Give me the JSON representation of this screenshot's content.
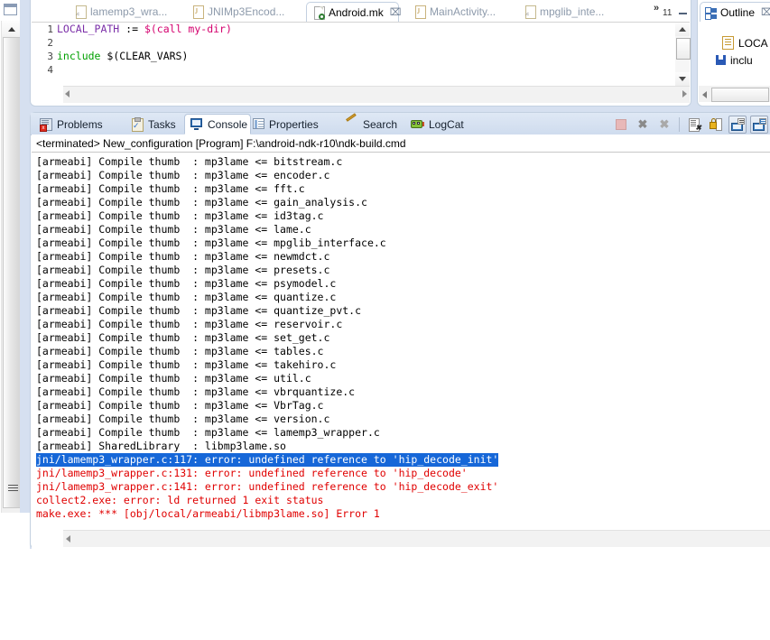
{
  "editor": {
    "tabs": [
      {
        "label": "lamemp3_wra...",
        "icon": "c-file-icon",
        "active": false
      },
      {
        "label": "JNIMp3Encod...",
        "icon": "java-file-icon",
        "active": false
      },
      {
        "label": "Android.mk",
        "icon": "makefile-icon",
        "active": true,
        "close": "⌧"
      },
      {
        "label": "MainActivity...",
        "icon": "java-file-icon",
        "active": false
      },
      {
        "label": "mpglib_inte...",
        "icon": "c-file-icon",
        "active": false
      }
    ],
    "overflow_chevron": "»",
    "overflow_count": "11",
    "minimize_tooltip": "Minimize",
    "maximize_tooltip": "Maximize",
    "code_lines": [
      {
        "num": "1",
        "parts": [
          {
            "t": "LOCAL_PATH ",
            "c": "k-var"
          },
          {
            "t": ":= ",
            "c": "k-op"
          },
          {
            "t": "$(call my-dir)",
            "c": "k-dollar"
          }
        ]
      },
      {
        "num": "2",
        "parts": [
          {
            "t": "",
            "c": "k-op"
          }
        ]
      },
      {
        "num": "3",
        "parts": [
          {
            "t": "include ",
            "c": "k-inc"
          },
          {
            "t": "$(CLEAR_VARS)",
            "c": "k-op"
          }
        ]
      },
      {
        "num": "4",
        "parts": [
          {
            "t": "",
            "c": "k-op"
          }
        ]
      }
    ]
  },
  "outline": {
    "title": "Outline",
    "close": "⌧",
    "items": [
      {
        "label": "LOCA",
        "icon": "field-icon"
      },
      {
        "label": "inclu",
        "icon": "include-icon"
      }
    ]
  },
  "console_view": {
    "tabs": [
      {
        "label": "Problems",
        "icon": "problems-icon",
        "active": false
      },
      {
        "label": "Tasks",
        "icon": "tasks-icon",
        "active": false
      },
      {
        "label": "Console",
        "icon": "console-icon",
        "active": true,
        "close": "⌧"
      },
      {
        "label": "Properties",
        "icon": "properties-icon",
        "active": false
      },
      {
        "label": "Search",
        "icon": "search-icon",
        "active": false
      },
      {
        "label": "LogCat",
        "icon": "logcat-icon",
        "active": false
      }
    ],
    "toolbar": [
      {
        "name": "terminate-button",
        "icon": "stop-square-icon"
      },
      {
        "name": "remove-launch-button",
        "icon": "x-icon"
      },
      {
        "name": "remove-all-terminated-button",
        "icon": "x-multiple-icon"
      },
      {
        "name": "clear-console-button",
        "icon": "clear-console-icon"
      },
      {
        "name": "scroll-lock-button",
        "icon": "lock-icon"
      },
      {
        "name": "pin-console-button",
        "icon": "pin-console-icon"
      },
      {
        "name": "display-selected-console-button",
        "icon": "display-console-icon"
      }
    ],
    "header": "<terminated> New_configuration [Program] F:\\android-ndk-r10\\ndk-build.cmd",
    "lines": [
      {
        "text": "[armeabi] Compile thumb  : mp3lame <= bitstream.c",
        "style": "normal"
      },
      {
        "text": "[armeabi] Compile thumb  : mp3lame <= encoder.c",
        "style": "normal"
      },
      {
        "text": "[armeabi] Compile thumb  : mp3lame <= fft.c",
        "style": "normal"
      },
      {
        "text": "[armeabi] Compile thumb  : mp3lame <= gain_analysis.c",
        "style": "normal"
      },
      {
        "text": "[armeabi] Compile thumb  : mp3lame <= id3tag.c",
        "style": "normal"
      },
      {
        "text": "[armeabi] Compile thumb  : mp3lame <= lame.c",
        "style": "normal"
      },
      {
        "text": "[armeabi] Compile thumb  : mp3lame <= mpglib_interface.c",
        "style": "normal"
      },
      {
        "text": "[armeabi] Compile thumb  : mp3lame <= newmdct.c",
        "style": "normal"
      },
      {
        "text": "[armeabi] Compile thumb  : mp3lame <= presets.c",
        "style": "normal"
      },
      {
        "text": "[armeabi] Compile thumb  : mp3lame <= psymodel.c",
        "style": "normal"
      },
      {
        "text": "[armeabi] Compile thumb  : mp3lame <= quantize.c",
        "style": "normal"
      },
      {
        "text": "[armeabi] Compile thumb  : mp3lame <= quantize_pvt.c",
        "style": "normal"
      },
      {
        "text": "[armeabi] Compile thumb  : mp3lame <= reservoir.c",
        "style": "normal"
      },
      {
        "text": "[armeabi] Compile thumb  : mp3lame <= set_get.c",
        "style": "normal"
      },
      {
        "text": "[armeabi] Compile thumb  : mp3lame <= tables.c",
        "style": "normal"
      },
      {
        "text": "[armeabi] Compile thumb  : mp3lame <= takehiro.c",
        "style": "normal"
      },
      {
        "text": "[armeabi] Compile thumb  : mp3lame <= util.c",
        "style": "normal"
      },
      {
        "text": "[armeabi] Compile thumb  : mp3lame <= vbrquantize.c",
        "style": "normal"
      },
      {
        "text": "[armeabi] Compile thumb  : mp3lame <= VbrTag.c",
        "style": "normal"
      },
      {
        "text": "[armeabi] Compile thumb  : mp3lame <= version.c",
        "style": "normal"
      },
      {
        "text": "[armeabi] Compile thumb  : mp3lame <= lamemp3_wrapper.c",
        "style": "normal"
      },
      {
        "text": "[armeabi] SharedLibrary  : libmp3lame.so",
        "style": "normal"
      },
      {
        "text": "jni/lamemp3_wrapper.c:117: error: undefined reference to 'hip_decode_init'",
        "style": "selected"
      },
      {
        "text": "jni/lamemp3_wrapper.c:131: error: undefined reference to 'hip_decode'",
        "style": "error"
      },
      {
        "text": "jni/lamemp3_wrapper.c:141: error: undefined reference to 'hip_decode_exit'",
        "style": "error"
      },
      {
        "text": "collect2.exe: error: ld returned 1 exit status",
        "style": "error"
      },
      {
        "text": "make.exe: *** [obj/local/armeabi/libmp3lame.so] Error 1",
        "style": "error"
      }
    ]
  },
  "colors": {
    "selection_blue": "#1667d8",
    "error_red": "#e00000",
    "tab_gradient_top": "#dfe8f5",
    "tab_gradient_bottom": "#cfdcee",
    "workbench_bg": "#d6e0f0"
  }
}
